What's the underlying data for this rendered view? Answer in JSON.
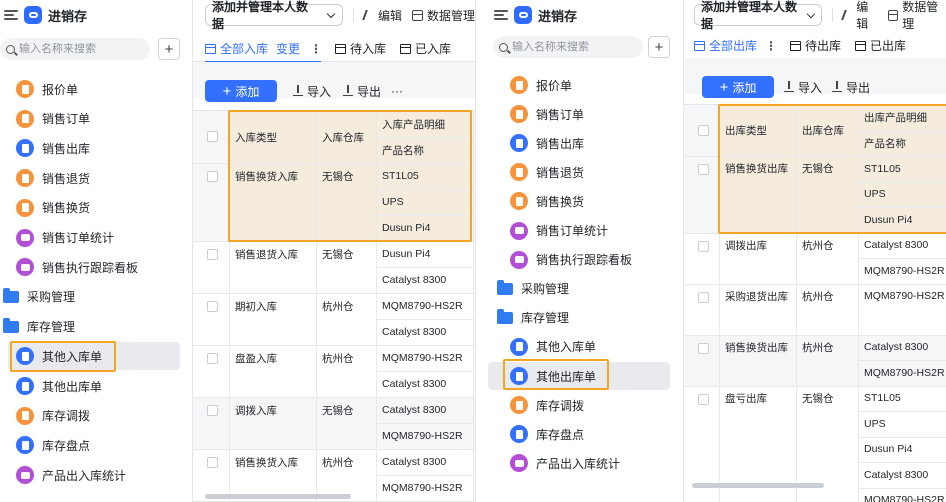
{
  "app": {
    "title": "进销存"
  },
  "search": {
    "placeholder": "输入名称来搜索"
  },
  "left_nav": [
    {
      "label": "报价单",
      "icon": "orange"
    },
    {
      "label": "销售订单",
      "icon": "orange"
    },
    {
      "label": "销售出库",
      "icon": "blue"
    },
    {
      "label": "销售退货",
      "icon": "orange"
    },
    {
      "label": "销售换货",
      "icon": "orange"
    },
    {
      "label": "销售订单统计",
      "icon": "purple"
    },
    {
      "label": "销售执行跟踪看板",
      "icon": "purple"
    },
    {
      "label": "采购管理",
      "icon": "folder"
    },
    {
      "label": "库存管理",
      "icon": "folder"
    },
    {
      "label": "其他入库单",
      "icon": "blue"
    },
    {
      "label": "其他出库单",
      "icon": "blue"
    },
    {
      "label": "库存调拨",
      "icon": "orange"
    },
    {
      "label": "库存盘点",
      "icon": "blue"
    },
    {
      "label": "产品出入库统计",
      "icon": "purple"
    }
  ],
  "right_nav": [
    {
      "label": "报价单",
      "icon": "orange"
    },
    {
      "label": "销售订单",
      "icon": "orange"
    },
    {
      "label": "销售出库",
      "icon": "blue"
    },
    {
      "label": "销售退货",
      "icon": "orange"
    },
    {
      "label": "销售换货",
      "icon": "orange"
    },
    {
      "label": "销售订单统计",
      "icon": "purple"
    },
    {
      "label": "销售执行跟踪看板",
      "icon": "purple"
    },
    {
      "label": "采购管理",
      "icon": "folder"
    },
    {
      "label": "库存管理",
      "icon": "folder"
    },
    {
      "label": "其他入库单",
      "icon": "blue"
    },
    {
      "label": "其他出库单",
      "icon": "blue"
    },
    {
      "label": "库存调拨",
      "icon": "orange"
    },
    {
      "label": "库存盘点",
      "icon": "blue"
    },
    {
      "label": "产品出入库统计",
      "icon": "purple"
    }
  ],
  "topbar": {
    "view_name": "添加并管理本人数据",
    "edit": "编辑",
    "data_manage": "数据管理"
  },
  "toolbar": {
    "add": "添加",
    "import": "导入",
    "export": "导出",
    "more": "···"
  },
  "left_main": {
    "tabs": [
      {
        "label": "全部入库",
        "active": true,
        "link": "变更"
      },
      {
        "label": "待入库"
      },
      {
        "label": "已入库"
      }
    ],
    "headers": {
      "type": "入库类型",
      "warehouse": "入库仓库",
      "detail": "入库产品明细",
      "product": "产品名称"
    },
    "rows": [
      {
        "type": "销售换货入库",
        "warehouse": "无锡仓",
        "products": [
          "ST1L05",
          "UPS",
          "Dusun Pi4"
        ],
        "shaded": true
      },
      {
        "type": "销售退货入库",
        "warehouse": "无锡仓",
        "products": [
          "Dusun Pi4",
          "Catalyst 8300"
        ]
      },
      {
        "type": "期初入库",
        "warehouse": "杭州仓",
        "products": [
          "MQM8790-HS2R",
          "Catalyst 8300"
        ]
      },
      {
        "type": "盘盈入库",
        "warehouse": "杭州仓",
        "products": [
          "MQM8790-HS2R",
          "Catalyst 8300"
        ]
      },
      {
        "type": "调拨入库",
        "warehouse": "无锡仓",
        "products": [
          "Catalyst 8300",
          "MQM8790-HS2R"
        ],
        "shaded": true
      },
      {
        "type": "销售换货入库",
        "warehouse": "杭州仓",
        "products": [
          "Catalyst 8300",
          "MQM8790-HS2R"
        ]
      }
    ]
  },
  "right_main": {
    "tabs": [
      {
        "label": "全部出库",
        "active": true
      },
      {
        "label": "待出库"
      },
      {
        "label": "已出库"
      }
    ],
    "headers": {
      "type": "出库类型",
      "warehouse": "出库仓库",
      "detail": "出库产品明细",
      "product": "产品名称"
    },
    "rows": [
      {
        "type": "销售换货出库",
        "warehouse": "无锡仓",
        "products": [
          "ST1L05",
          "UPS",
          "Dusun Pi4"
        ],
        "shaded": true
      },
      {
        "type": "调拨出库",
        "warehouse": "杭州仓",
        "products": [
          "Catalyst 8300",
          "MQM8790-HS2R"
        ]
      },
      {
        "type": "采购退货出库",
        "warehouse": "杭州仓",
        "products": [
          "MQM8790-HS2R"
        ]
      },
      {
        "type": "销售换货出库",
        "warehouse": "杭州仓",
        "products": [
          "Catalyst 8300",
          "MQM8790-HS2R"
        ],
        "shaded": true
      },
      {
        "type": "盘亏出库",
        "warehouse": "无锡仓",
        "products": [
          "ST1L05",
          "UPS",
          "Dusun Pi4",
          "Catalyst 8300",
          "MQM8790-HS2R"
        ]
      }
    ]
  },
  "colors": {
    "accent": "#3370ff",
    "highlight": "#f5a524",
    "orange": "#f5943c",
    "purple": "#b24fd6"
  }
}
